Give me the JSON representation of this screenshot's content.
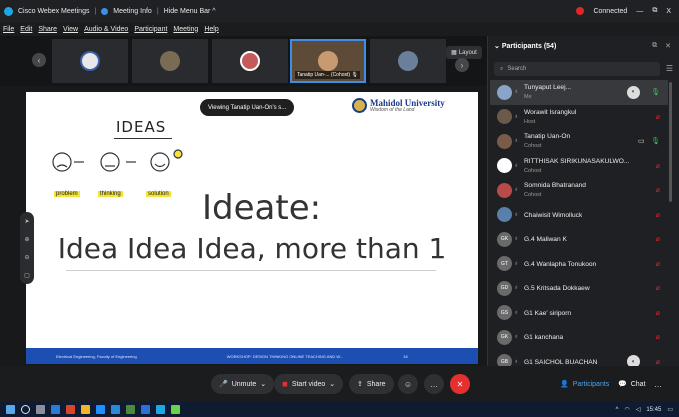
{
  "titlebar": {
    "app_title": "Cisco Webex Meetings",
    "meeting_info": "Meeting Info",
    "hide_menu": "Hide Menu Bar ^",
    "status": "Connected",
    "win_min": "—",
    "win_max": "⧉",
    "win_close": "X"
  },
  "menubar": [
    "File",
    "Edit",
    "Share",
    "View",
    "Audio & Video",
    "Participant",
    "Meeting",
    "Help"
  ],
  "strip": {
    "active_label": "Tanatip Uan-... (Cohost) 🎙",
    "layout_label": "Layout"
  },
  "slide": {
    "viewing_text": "Viewing Tanatip Uan-On's s...",
    "university_name": "Mahidol University",
    "university_sub": "Wisdom of the Land",
    "ideas_word": "IDEAS",
    "tag_problem": "problem",
    "tag_thinking": "thinking",
    "tag_solution": "solution",
    "ideate": "Ideate:",
    "idea_line": "Idea Idea Idea, more than 1",
    "footer_left": "Electrical Engineering, Faculty of Engineering",
    "footer_mid": "WORKSHOP: DESIGN THINKING ONLINE TEACHING AND W...",
    "footer_page": "16"
  },
  "controls": {
    "unmute": "Unmute",
    "start_video": "Start video",
    "share": "Share",
    "participants": "Participants",
    "chat": "Chat"
  },
  "participants_panel": {
    "title": "Participants (54)",
    "search_placeholder": "Search",
    "people": [
      {
        "name": "Tunyaput Leej...",
        "role": "Me",
        "avatar_color": "#8aa4c8",
        "initials": "",
        "mute": "green",
        "extra": "",
        "badge": true,
        "selected": true
      },
      {
        "name": "Worawit Israngkul",
        "role": "Host",
        "avatar_color": "#6b5a4a",
        "initials": "",
        "mute": "red",
        "extra": "",
        "badge": false,
        "selected": false
      },
      {
        "name": "Tanatip Uan-On",
        "role": "Cohost",
        "avatar_color": "#7a5a48",
        "initials": "",
        "mute": "green",
        "extra": "▭",
        "badge": false,
        "selected": false
      },
      {
        "name": "RITTHISAK SIRIKUNASAKULWO...",
        "role": "Cohost",
        "avatar_color": "#ffffff",
        "initials": "",
        "mute": "red",
        "extra": "",
        "badge": false,
        "selected": false
      },
      {
        "name": "Somnida Bhatranand",
        "role": "Cohost",
        "avatar_color": "#b94a4a",
        "initials": "",
        "mute": "red",
        "extra": "",
        "badge": false,
        "selected": false
      },
      {
        "name": "Chaiwisit Wimolluck",
        "role": "",
        "avatar_color": "#5a7fa8",
        "initials": "",
        "mute": "red",
        "extra": "",
        "badge": false,
        "selected": false
      },
      {
        "name": "G.4 Maliwan K",
        "role": "",
        "avatar_color": "#6a6a6a",
        "initials": "GK",
        "mute": "red",
        "extra": "",
        "badge": false,
        "selected": false
      },
      {
        "name": "G.4 Wanlapha Tonukoon",
        "role": "",
        "avatar_color": "#6a6a6a",
        "initials": "GT",
        "mute": "red",
        "extra": "",
        "badge": false,
        "selected": false
      },
      {
        "name": "G.5 Kritsada Dokkaew",
        "role": "",
        "avatar_color": "#6a6a6a",
        "initials": "GD",
        "mute": "red",
        "extra": "",
        "badge": false,
        "selected": false
      },
      {
        "name": "G1 Kae' siriporn",
        "role": "",
        "avatar_color": "#6a6a6a",
        "initials": "GS",
        "mute": "red",
        "extra": "",
        "badge": false,
        "selected": false
      },
      {
        "name": "G1 kanchana",
        "role": "",
        "avatar_color": "#6a6a6a",
        "initials": "GK",
        "mute": "red",
        "extra": "",
        "badge": false,
        "selected": false
      },
      {
        "name": "G1 SAICHOL BUACHAN",
        "role": "",
        "avatar_color": "#6a6a6a",
        "initials": "GB",
        "mute": "red",
        "extra": "",
        "badge": true,
        "selected": false
      }
    ]
  },
  "taskbar": {
    "clock": "15:45"
  }
}
